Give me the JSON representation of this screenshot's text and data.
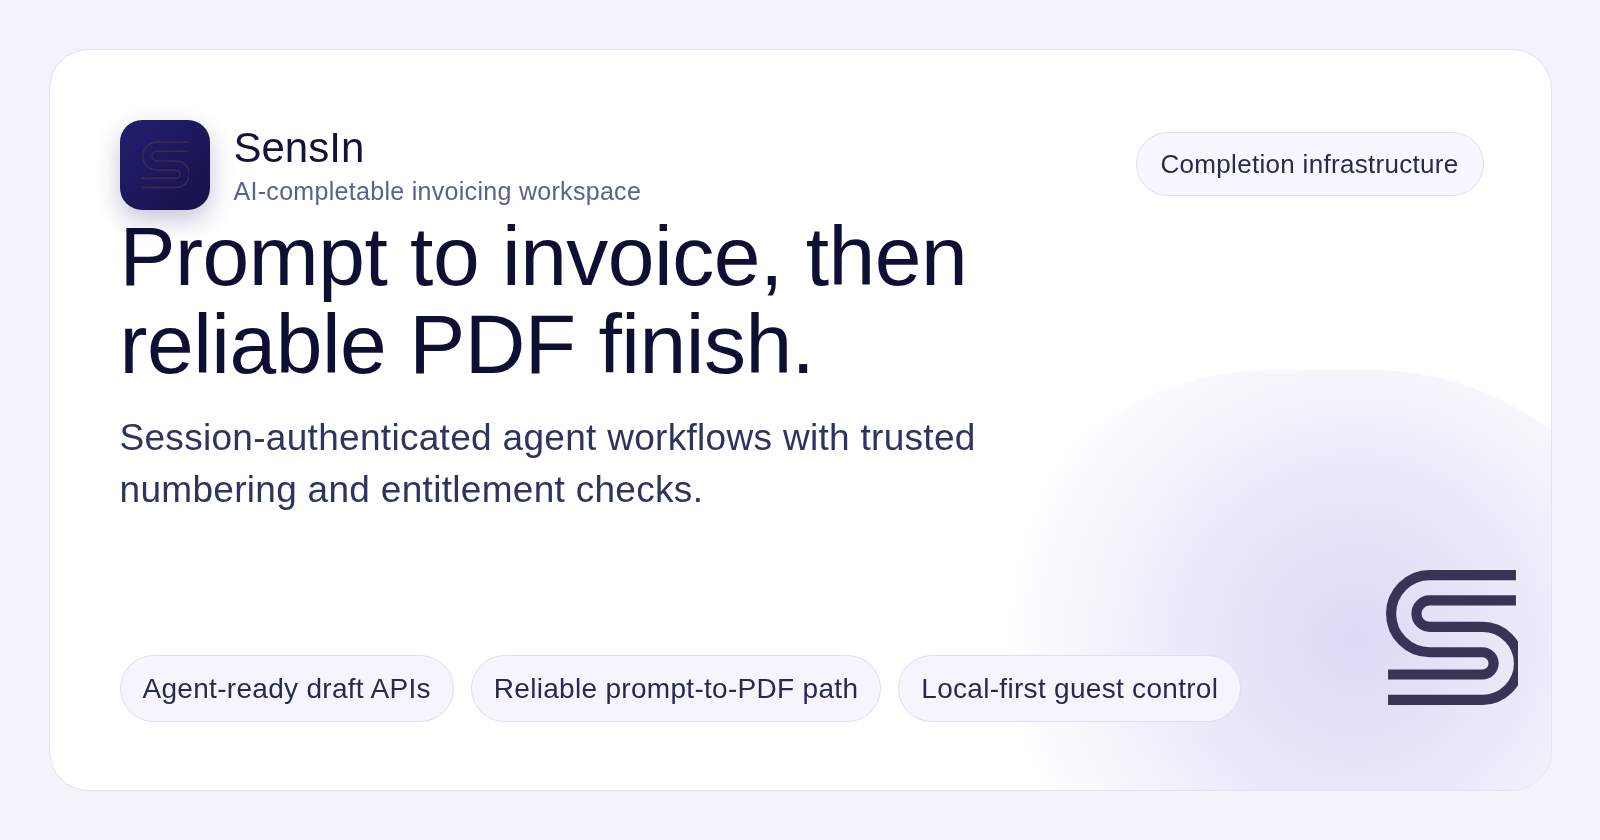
{
  "brand": {
    "name": "SensIn",
    "tagline": "AI-completable invoicing workspace"
  },
  "badge": "Completion infrastructure",
  "headline": [
    "Prompt to invoice, then",
    "reliable PDF finish."
  ],
  "subtitle": "Session-authenticated agent workflows with trusted numbering and entitlement checks.",
  "features": [
    "Agent-ready draft APIs",
    "Reliable prompt-to-PDF path",
    "Local-first guest control"
  ]
}
